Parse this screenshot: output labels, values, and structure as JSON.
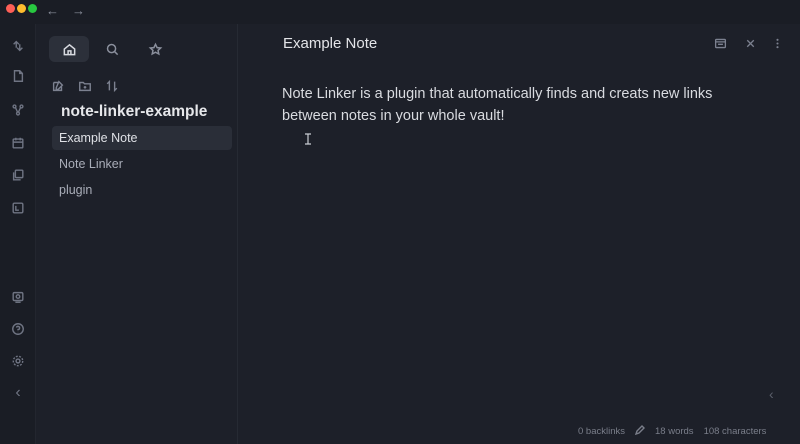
{
  "titlebar": {
    "back_icon": "arrow-left-icon",
    "forward_icon": "arrow-right-icon",
    "back_glyph": "←",
    "forward_glyph": "→"
  },
  "ribbon": {
    "icons": [
      "switcher-icon",
      "file-icon",
      "graph-icon",
      "calendar-icon",
      "copy-icon",
      "terminal-icon",
      "vault-icon",
      "help-icon",
      "settings-icon"
    ],
    "collapse_glyph": "‹"
  },
  "sidebar": {
    "tabs": [
      "home-icon",
      "search-icon",
      "star-icon"
    ],
    "tools": [
      "new-note-icon",
      "new-folder-icon",
      "sort-icon"
    ],
    "vault_name": "note-linker-example",
    "files": [
      {
        "label": "Example Note",
        "active": true
      },
      {
        "label": "Note Linker",
        "active": false
      },
      {
        "label": "plugin",
        "active": false
      }
    ]
  },
  "main": {
    "title": "Example Note",
    "header_icons": [
      "reading-view-icon",
      "close-icon",
      "more-options-icon"
    ],
    "body": "Note Linker is a plugin that automatically finds and creats new links between notes in your whole vault!",
    "collapse_glyph": "‹"
  },
  "status": {
    "backlinks": "0 backlinks",
    "words": "18 words",
    "characters": "108 characters"
  },
  "colors": {
    "background": "#1d2029",
    "ribbon": "#1a1d25",
    "active_item": "#2a2e38",
    "text": "#dcdde1"
  }
}
